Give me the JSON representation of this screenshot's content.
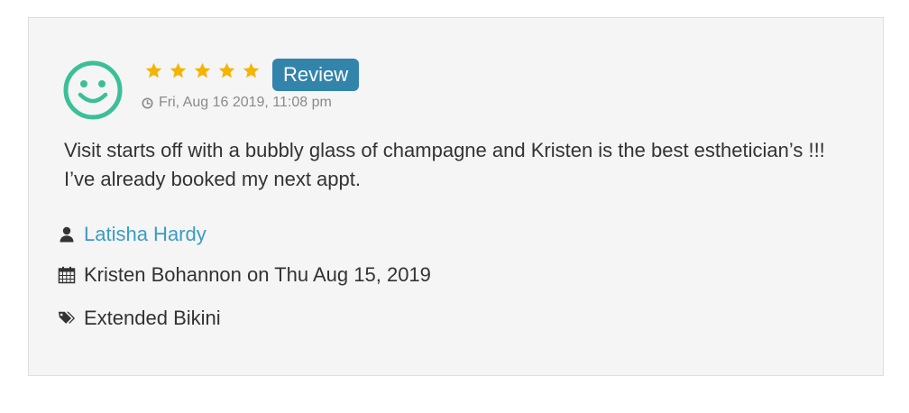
{
  "review": {
    "badge_label": "Review",
    "rating": 5,
    "rating_max": 5,
    "timestamp": "Fri, Aug 16 2019, 11:08 pm",
    "text": "Visit starts off with a bubbly glass of champagne and Kristen is the best esthetician’s !!! I’ve already booked my next appt.",
    "author": "Latisha Hardy",
    "appointment": "Kristen Bohannon on Thu Aug 15, 2019",
    "service": "Extended Bikini"
  },
  "icons": {
    "avatar": "smiley-face-icon",
    "star": "star-icon",
    "clock": "clock-icon",
    "user": "user-icon",
    "calendar": "calendar-icon",
    "tags": "tags-icon"
  },
  "colors": {
    "avatar": "#3cbf98",
    "star": "#f4b400",
    "badge_bg": "#3384ab",
    "link": "#3a9cc3",
    "card_bg": "#f5f5f5"
  }
}
